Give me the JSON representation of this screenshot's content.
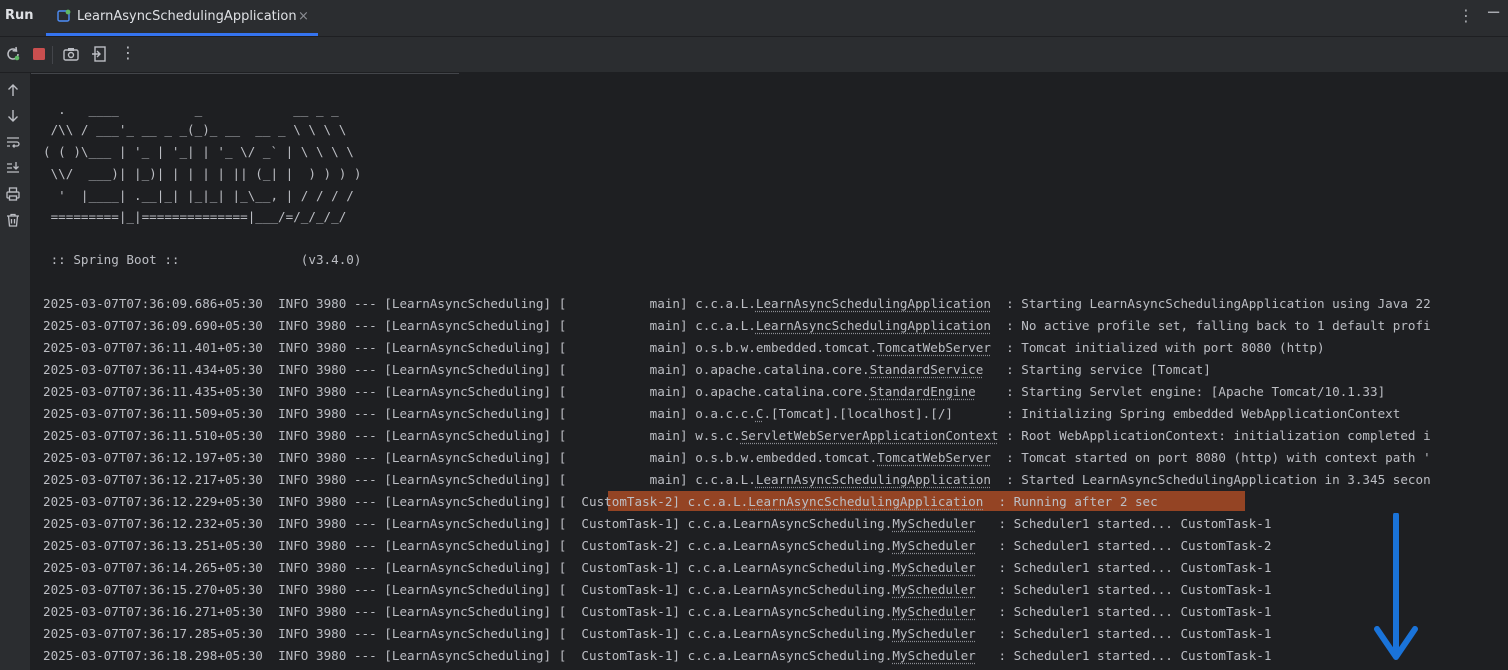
{
  "tabbar": {
    "run_label": "Run",
    "tab_title": "LearnAsyncSchedulingApplication",
    "close_glyph": "×",
    "menu_glyph": "⋮",
    "minimize_glyph": "−"
  },
  "toolbar": {
    "icons": [
      "rerun-icon",
      "stop-icon",
      "camera-icon",
      "exit-icon",
      "more-icon"
    ],
    "more_glyph": "⋮"
  },
  "sidebar": {
    "icons": [
      "arrow-up-icon",
      "arrow-down-icon",
      "soft-wrap-icon",
      "scroll-to-end-icon",
      "print-icon",
      "trash-icon"
    ]
  },
  "banner": [
    "  .   ____          _            __ _ _",
    " /\\\\ / ___'_ __ _ _(_)_ __  __ _ \\ \\ \\ \\",
    "( ( )\\___ | '_ | '_| | '_ \\/ _` | \\ \\ \\ \\",
    " \\\\/  ___)| |_)| | | | | || (_| |  ) ) ) )",
    "  '  |____| .__|_| |_|_| |_\\__, | / / / /",
    " =========|_|==============|___/=/_/_/_/",
    "",
    " :: Spring Boot ::                (v3.4.0)"
  ],
  "logs": [
    {
      "ts": "2025-03-07T07:36:09.686+05:30",
      "lvl": "INFO",
      "pid": "3980",
      "sep": "---",
      "app": "[LearnAsyncScheduling]",
      "thread": "[           main]",
      "lp": "c.c.a.L.",
      "lc": "LearnAsyncSchedulingApplication",
      "pad": "  ",
      "msg": ": Starting LearnAsyncSchedulingApplication using Java 22"
    },
    {
      "ts": "2025-03-07T07:36:09.690+05:30",
      "lvl": "INFO",
      "pid": "3980",
      "sep": "---",
      "app": "[LearnAsyncScheduling]",
      "thread": "[           main]",
      "lp": "c.c.a.L.",
      "lc": "LearnAsyncSchedulingApplication",
      "pad": "  ",
      "msg": ": No active profile set, falling back to 1 default profi"
    },
    {
      "ts": "2025-03-07T07:36:11.401+05:30",
      "lvl": "INFO",
      "pid": "3980",
      "sep": "---",
      "app": "[LearnAsyncScheduling]",
      "thread": "[           main]",
      "lp": "o.s.b.w.embedded.tomcat.",
      "lc": "TomcatWebServer",
      "pad": "  ",
      "msg": ": Tomcat initialized with port 8080 (http)"
    },
    {
      "ts": "2025-03-07T07:36:11.434+05:30",
      "lvl": "INFO",
      "pid": "3980",
      "sep": "---",
      "app": "[LearnAsyncScheduling]",
      "thread": "[           main]",
      "lp": "o.apache.catalina.core.",
      "lc": "StandardService",
      "pad": "   ",
      "msg": ": Starting service [Tomcat]"
    },
    {
      "ts": "2025-03-07T07:36:11.435+05:30",
      "lvl": "INFO",
      "pid": "3980",
      "sep": "---",
      "app": "[LearnAsyncScheduling]",
      "thread": "[           main]",
      "lp": "o.apache.catalina.core.",
      "lc": "StandardEngine",
      "pad": "    ",
      "msg": ": Starting Servlet engine: [Apache Tomcat/10.1.33]"
    },
    {
      "ts": "2025-03-07T07:36:11.509+05:30",
      "lvl": "INFO",
      "pid": "3980",
      "sep": "---",
      "app": "[LearnAsyncScheduling]",
      "thread": "[           main]",
      "lp": "o.a.c.c.",
      "lc": "C",
      "pad": "",
      "msg": ".[Tomcat].[localhost].[/]       : Initializing Spring embedded WebApplicationContext"
    },
    {
      "ts": "2025-03-07T07:36:11.510+05:30",
      "lvl": "INFO",
      "pid": "3980",
      "sep": "---",
      "app": "[LearnAsyncScheduling]",
      "thread": "[           main]",
      "lp": "w.s.c.",
      "lc": "ServletWebServerApplicationContext",
      "pad": " ",
      "msg": ": Root WebApplicationContext: initialization completed i"
    },
    {
      "ts": "2025-03-07T07:36:12.197+05:30",
      "lvl": "INFO",
      "pid": "3980",
      "sep": "---",
      "app": "[LearnAsyncScheduling]",
      "thread": "[           main]",
      "lp": "o.s.b.w.embedded.tomcat.",
      "lc": "TomcatWebServer",
      "pad": "  ",
      "msg": ": Tomcat started on port 8080 (http) with context path '"
    },
    {
      "ts": "2025-03-07T07:36:12.217+05:30",
      "lvl": "INFO",
      "pid": "3980",
      "sep": "---",
      "app": "[LearnAsyncScheduling]",
      "thread": "[           main]",
      "lp": "c.c.a.L.",
      "lc": "LearnAsyncSchedulingApplication",
      "pad": "  ",
      "msg": ": Started LearnAsyncSchedulingApplication in 3.345 secon"
    },
    {
      "ts": "2025-03-07T07:36:12.229+05:30",
      "lvl": "INFO",
      "pid": "3980",
      "sep": "---",
      "app": "[LearnAsyncScheduling]",
      "thread": "[  CustomTask-2]",
      "lp": "c.c.a.L.",
      "lc": "LearnAsyncSchedulingApplication",
      "pad": "  ",
      "msg": ": Running after 2 sec"
    },
    {
      "ts": "2025-03-07T07:36:12.232+05:30",
      "lvl": "INFO",
      "pid": "3980",
      "sep": "---",
      "app": "[LearnAsyncScheduling]",
      "thread": "[  CustomTask-1]",
      "lp": "c.c.a.LearnAsyncScheduling.",
      "lc": "MyScheduler",
      "pad": "   ",
      "msg": ": Scheduler1 started... CustomTask-1"
    },
    {
      "ts": "2025-03-07T07:36:13.251+05:30",
      "lvl": "INFO",
      "pid": "3980",
      "sep": "---",
      "app": "[LearnAsyncScheduling]",
      "thread": "[  CustomTask-2]",
      "lp": "c.c.a.LearnAsyncScheduling.",
      "lc": "MyScheduler",
      "pad": "   ",
      "msg": ": Scheduler1 started... CustomTask-2"
    },
    {
      "ts": "2025-03-07T07:36:14.265+05:30",
      "lvl": "INFO",
      "pid": "3980",
      "sep": "---",
      "app": "[LearnAsyncScheduling]",
      "thread": "[  CustomTask-1]",
      "lp": "c.c.a.LearnAsyncScheduling.",
      "lc": "MyScheduler",
      "pad": "   ",
      "msg": ": Scheduler1 started... CustomTask-1"
    },
    {
      "ts": "2025-03-07T07:36:15.270+05:30",
      "lvl": "INFO",
      "pid": "3980",
      "sep": "---",
      "app": "[LearnAsyncScheduling]",
      "thread": "[  CustomTask-1]",
      "lp": "c.c.a.LearnAsyncScheduling.",
      "lc": "MyScheduler",
      "pad": "   ",
      "msg": ": Scheduler1 started... CustomTask-1"
    },
    {
      "ts": "2025-03-07T07:36:16.271+05:30",
      "lvl": "INFO",
      "pid": "3980",
      "sep": "---",
      "app": "[LearnAsyncScheduling]",
      "thread": "[  CustomTask-1]",
      "lp": "c.c.a.LearnAsyncScheduling.",
      "lc": "MyScheduler",
      "pad": "   ",
      "msg": ": Scheduler1 started... CustomTask-1"
    },
    {
      "ts": "2025-03-07T07:36:17.285+05:30",
      "lvl": "INFO",
      "pid": "3980",
      "sep": "---",
      "app": "[LearnAsyncScheduling]",
      "thread": "[  CustomTask-1]",
      "lp": "c.c.a.LearnAsyncScheduling.",
      "lc": "MyScheduler",
      "pad": "   ",
      "msg": ": Scheduler1 started... CustomTask-1"
    },
    {
      "ts": "2025-03-07T07:36:18.298+05:30",
      "lvl": "INFO",
      "pid": "3980",
      "sep": "---",
      "app": "[LearnAsyncScheduling]",
      "thread": "[  CustomTask-1]",
      "lp": "c.c.a.LearnAsyncScheduling.",
      "lc": "MyScheduler",
      "pad": "   ",
      "msg": ": Scheduler1 started... CustomTask-1"
    }
  ],
  "colors": {
    "highlight": "#a94b24",
    "arrow": "#1a73d9",
    "accent": "#3574f0"
  }
}
